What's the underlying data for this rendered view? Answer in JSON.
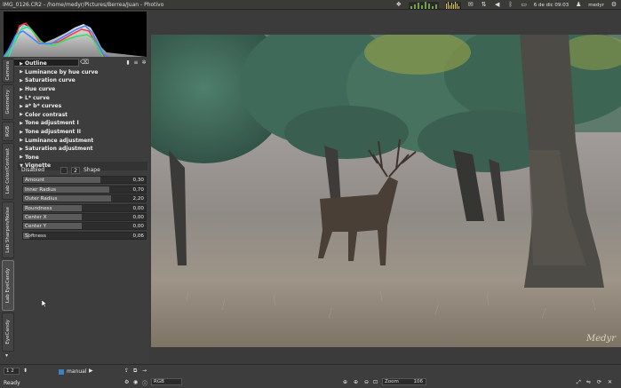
{
  "window": {
    "title": "IMG_0126.CR2 - /home/medyr/Pictures/Berrea/Juan - Photivo"
  },
  "tray": {
    "date_time": "6 de dic 09:03",
    "user": "medyr",
    "icons": [
      "dropbox-icon",
      "network-graph",
      "cpu-graph",
      "mail-icon",
      "network-icon",
      "volume-icon",
      "bluetooth-icon",
      "battery-icon",
      "user-icon",
      "gear-icon"
    ]
  },
  "tabs": [
    {
      "label": "Camera",
      "active": false
    },
    {
      "label": "Geometry",
      "active": false
    },
    {
      "label": "RGB",
      "active": false
    },
    {
      "label": "Lab Color/Contrast",
      "active": false
    },
    {
      "label": "Lab Sharpen/Noise",
      "active": false
    },
    {
      "label": "Lab EyeCandy",
      "active": true
    },
    {
      "label": "EyeCandy",
      "active": false
    }
  ],
  "tools": [
    {
      "label": "Outline",
      "open": false
    },
    {
      "label": "Luminance by hue curve",
      "open": false
    },
    {
      "label": "Saturation curve",
      "open": false
    },
    {
      "label": "Hue curve",
      "open": false
    },
    {
      "label": "L* curve",
      "open": false
    },
    {
      "label": "a* b* curves",
      "open": false
    },
    {
      "label": "Color contrast",
      "open": false
    },
    {
      "label": "Tone adjustment I",
      "open": false
    },
    {
      "label": "Tone adjustment II",
      "open": false
    },
    {
      "label": "Luminance adjustment",
      "open": false
    },
    {
      "label": "Saturation adjustment",
      "open": false
    },
    {
      "label": "Tone",
      "open": false
    },
    {
      "label": "Vignette",
      "open": true
    }
  ],
  "vignette": {
    "mode": "Disabled",
    "shape_value": "2",
    "shape_label": "Shape",
    "sliders": [
      {
        "label": "Amount",
        "value": "0,30",
        "fill": 0.63
      },
      {
        "label": "Inner Radius",
        "value": "0,70",
        "fill": 0.7
      },
      {
        "label": "Outer Radius",
        "value": "2,20",
        "fill": 0.72
      },
      {
        "label": "Roundness",
        "value": "0,00",
        "fill": 0.48
      },
      {
        "label": "Center X",
        "value": "0,00",
        "fill": 0.48
      },
      {
        "label": "Center Y",
        "value": "0,00",
        "fill": 0.48
      },
      {
        "label": "Softness",
        "value": "0,06",
        "fill": 0.05
      }
    ]
  },
  "canvas": {
    "watermark": "Medyr"
  },
  "bottom": {
    "page": "1 2",
    "manual_label": "manual",
    "colorspace": "RGB",
    "zoom_label": "Zoom",
    "zoom_value": "106",
    "status": "Ready"
  }
}
